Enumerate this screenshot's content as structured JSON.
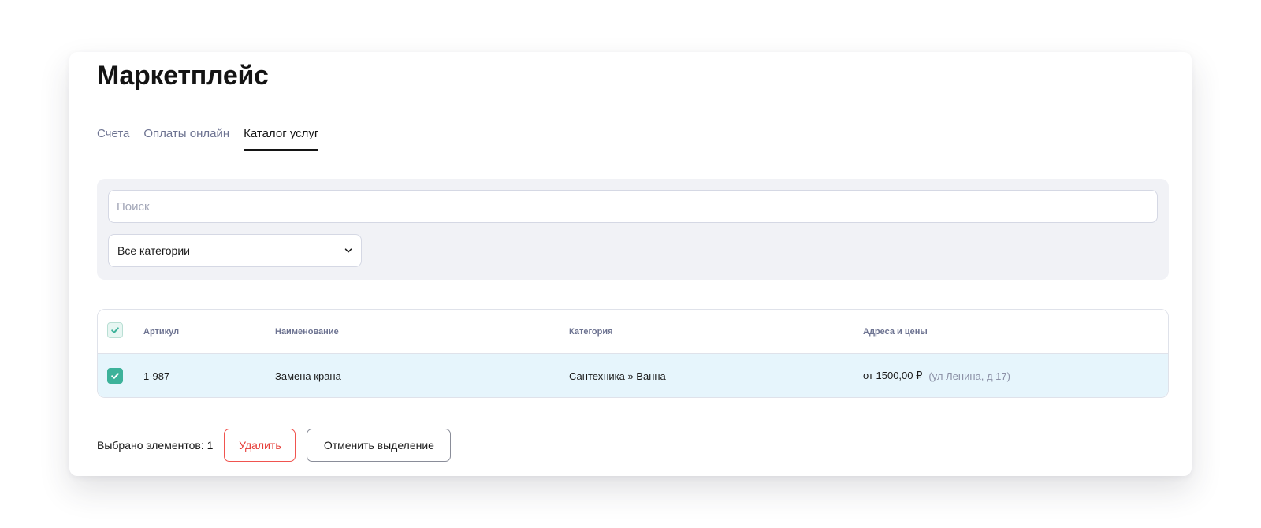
{
  "page": {
    "title": "Маркетплейс"
  },
  "tabs": [
    {
      "label": "Счета",
      "active": false
    },
    {
      "label": "Оплаты онлайн",
      "active": false
    },
    {
      "label": "Каталог услуг",
      "active": true
    }
  ],
  "filters": {
    "search_placeholder": "Поиск",
    "search_value": "",
    "category_select": {
      "value": "Все категории",
      "icon": "chevron-down-icon"
    }
  },
  "table": {
    "columns": [
      "Артикул",
      "Наименование",
      "Категория",
      "Адреса и цены"
    ],
    "header_checkbox_checked": true,
    "rows": [
      {
        "checked": true,
        "sku": "1-987",
        "name": "Замена крана",
        "category": "Сантехника » Ванна",
        "price": "от 1500,00 ₽",
        "address": "(ул Ленина, д 17)"
      }
    ]
  },
  "footer": {
    "selected_label": "Выбрано элементов: 1",
    "delete_label": "Удалить",
    "cancel_label": "Отменить выделение"
  },
  "colors": {
    "accent_checkbox": "#3db29a",
    "selected_row_bg": "#e6f5fc",
    "danger": "#e63c37",
    "tab_inactive": "#6d7391",
    "panel_bg": "#f1f2f6"
  }
}
